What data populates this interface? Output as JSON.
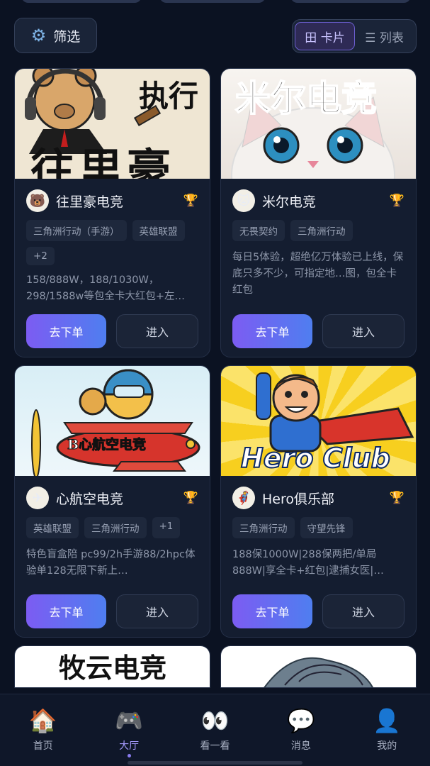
{
  "toolbar": {
    "filter_label": "筛选",
    "view_card_label": "田 卡片",
    "view_list_label": "☰ 列表"
  },
  "cards": [
    {
      "image_text": [
        "执行",
        "往里豪"
      ],
      "name": "往里豪电竞",
      "tags": [
        "三角洲行动（手游）",
        "英雄联盟",
        "+2"
      ],
      "desc": "158/888W，188/1030W，298/1588w等包全卡大红包+左…",
      "order_label": "去下单",
      "enter_label": "进入"
    },
    {
      "image_text": [
        "米尔电竞"
      ],
      "name": "米尔电竞",
      "tags": [
        "无畏契约",
        "三角洲行动"
      ],
      "desc": "每日5体验，超绝亿万体验已上线，保底只多不少，可指定地…图，包全卡红包",
      "order_label": "去下单",
      "enter_label": "进入"
    },
    {
      "image_text": [
        "B心航空电竞"
      ],
      "name": "心航空电竞",
      "tags": [
        "英雄联盟",
        "三角洲行动",
        "+1"
      ],
      "desc": "特色盲盒陪 pc99/2h手游88/2hpc体验单128无限下新上…",
      "order_label": "去下单",
      "enter_label": "进入"
    },
    {
      "image_text": [
        "Hero Club"
      ],
      "name": "Hero俱乐部",
      "tags": [
        "三角洲行动",
        "守望先锋"
      ],
      "desc": "188保1000W|288保两把/单局888W|享全卡+红包|逮捕女医|…",
      "order_label": "去下单",
      "enter_label": "进入"
    },
    {
      "image_text": [
        "牧云电竞"
      ]
    },
    {
      "image_text": []
    }
  ],
  "tabbar": [
    {
      "icon": "house-icon",
      "glyph": "🏠",
      "label": "首页",
      "active": false
    },
    {
      "icon": "gamepad-icon",
      "glyph": "🎮",
      "label": "大厅",
      "active": true
    },
    {
      "icon": "eyes-icon",
      "glyph": "👀",
      "label": "看一看",
      "active": false
    },
    {
      "icon": "chat-bubble-icon",
      "glyph": "💬",
      "label": "消息",
      "active": false
    },
    {
      "icon": "person-icon",
      "glyph": "👤",
      "label": "我的",
      "active": false
    }
  ],
  "colors": {
    "background": "#0b1222",
    "card": "#141d30",
    "accent_gradient_start": "#7c5cf2",
    "accent_gradient_end": "#4f7ef0",
    "trophy": "#e6b422",
    "active_tab": "#a79cff"
  }
}
